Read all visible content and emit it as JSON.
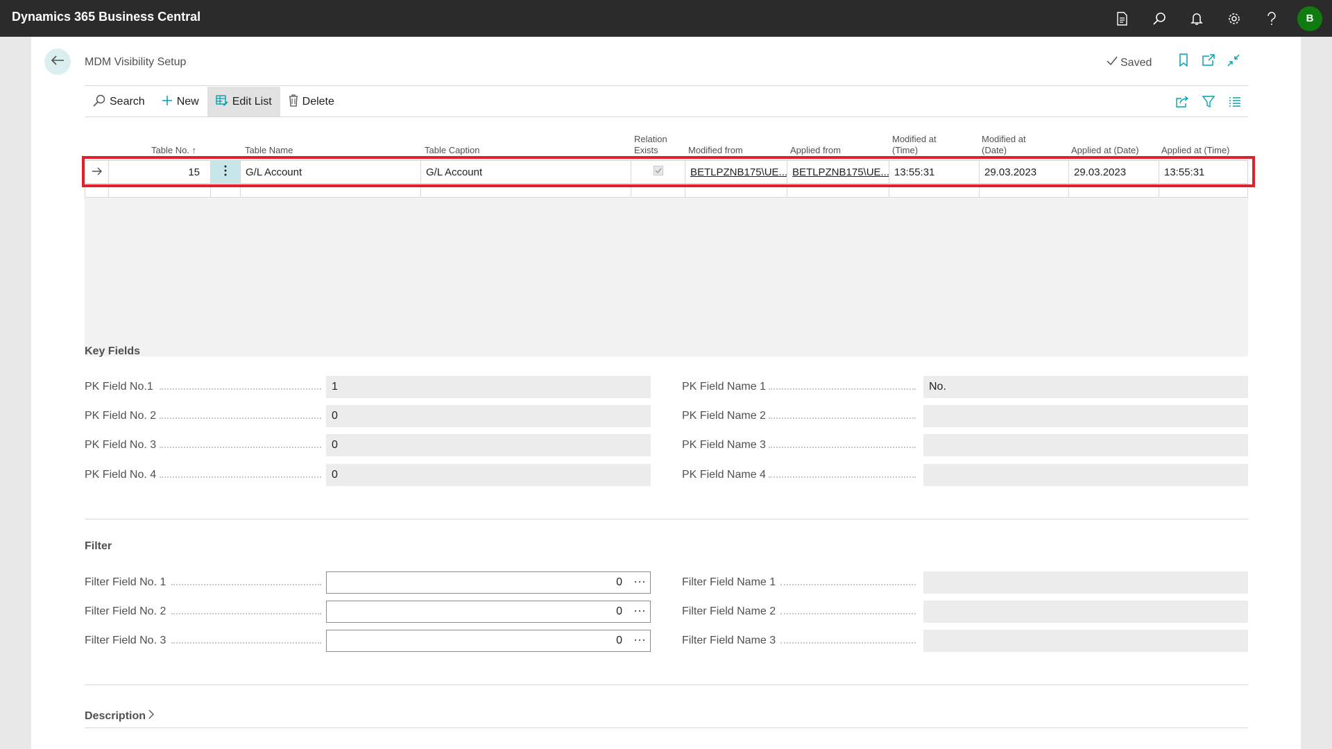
{
  "app": {
    "title": "Dynamics 365 Business Central",
    "avatar_initial": "B"
  },
  "page": {
    "title": "MDM Visibility Setup",
    "saved_label": "Saved"
  },
  "actions": {
    "search": "Search",
    "new": "New",
    "edit_list": "Edit List",
    "delete": "Delete"
  },
  "grid": {
    "headers": {
      "table_no": "Table No. ↑",
      "table_name": "Table Name",
      "table_caption": "Table Caption",
      "relation_exists_1": "Relation",
      "relation_exists_2": "Exists",
      "modified_from": "Modified from",
      "applied_from": "Applied from",
      "modified_time_1": "Modified at",
      "modified_time_2": "(Time)",
      "modified_date_1": "Modified at",
      "modified_date_2": "(Date)",
      "applied_date": "Applied at (Date)",
      "applied_time": "Applied at (Time)"
    },
    "rows": [
      {
        "table_no": "15",
        "table_name": "G/L Account",
        "table_caption": "G/L Account",
        "relation_exists": true,
        "modified_from": "BETLPZNB175\\UE...",
        "applied_from": "BETLPZNB175\\UE...",
        "modified_time": "13:55:31",
        "modified_date": "29.03.2023",
        "applied_date": "29.03.2023",
        "applied_time": "13:55:31"
      }
    ]
  },
  "key_fields": {
    "title": "Key Fields",
    "pk_no_1_label": "PK Field No.1",
    "pk_no_1": "1",
    "pk_no_2_label": "PK Field No. 2",
    "pk_no_2": "0",
    "pk_no_3_label": "PK Field No. 3",
    "pk_no_3": "0",
    "pk_no_4_label": "PK Field No. 4",
    "pk_no_4": "0",
    "pk_name_1_label": "PK Field Name 1",
    "pk_name_1": "No.",
    "pk_name_2_label": "PK Field Name 2",
    "pk_name_2": "",
    "pk_name_3_label": "PK Field Name 3",
    "pk_name_3": "",
    "pk_name_4_label": "PK Field Name 4",
    "pk_name_4": ""
  },
  "filter": {
    "title": "Filter",
    "no_1_label": "Filter Field No. 1",
    "no_1": "0",
    "no_2_label": "Filter Field No. 2",
    "no_2": "0",
    "no_3_label": "Filter Field No. 3",
    "no_3": "0",
    "name_1_label": "Filter Field Name 1",
    "name_1": "",
    "name_2_label": "Filter Field Name 2",
    "name_2": "",
    "name_3_label": "Filter Field Name 3",
    "name_3": "",
    "ellipsis": "⋯"
  },
  "description": {
    "title": "Description"
  },
  "colors": {
    "accent": "#00a2ad",
    "highlight": "#e0202e",
    "avatar": "#107c10",
    "topbar": "#2b2b2b"
  }
}
